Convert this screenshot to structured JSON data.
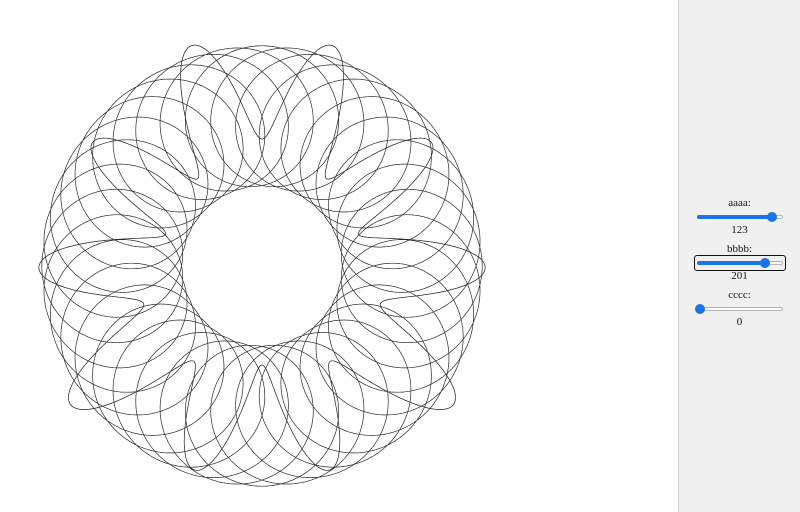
{
  "controls": [
    {
      "label": "aaaa:",
      "value": "123",
      "fraction": 0.88,
      "focused": false
    },
    {
      "label": "bbbb:",
      "value": "201",
      "fraction": 0.8,
      "focused": true
    },
    {
      "label": "cccc:",
      "value": "0",
      "fraction": 0.0,
      "focused": false
    }
  ],
  "colors": {
    "accent": "#1a73e8",
    "stroke": "#2a2a2a",
    "panel": "#f0f0f0"
  }
}
